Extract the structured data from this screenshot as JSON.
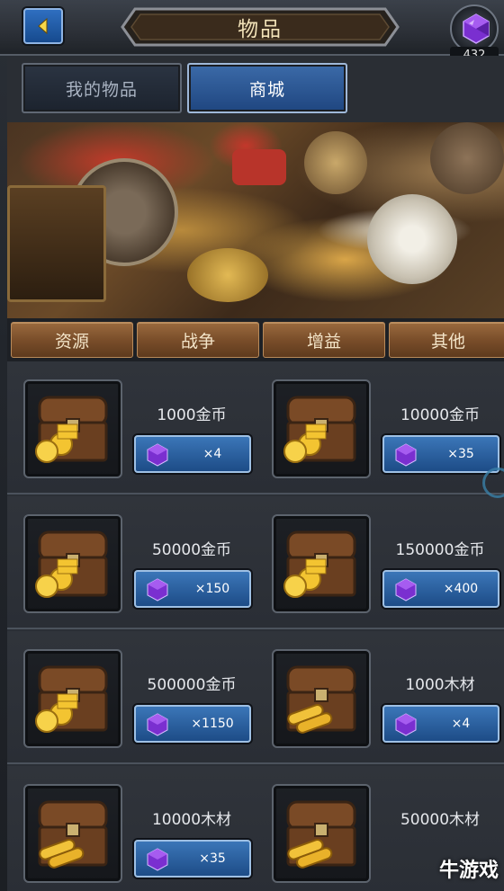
{
  "header": {
    "title": "物品",
    "gem_count": "432",
    "icons": {
      "back": "back-arrow-icon",
      "currency": "purple-gem-icon"
    }
  },
  "tabs": [
    {
      "label": "我的物品",
      "active": false
    },
    {
      "label": "商城",
      "active": true
    }
  ],
  "categories": [
    {
      "label": "资源"
    },
    {
      "label": "战争"
    },
    {
      "label": "增益"
    },
    {
      "label": "其他"
    }
  ],
  "items": [
    {
      "name": "1000金币",
      "price": "×4",
      "icon": "gold-chest-icon"
    },
    {
      "name": "10000金币",
      "price": "×35",
      "icon": "gold-chest-icon"
    },
    {
      "name": "50000金币",
      "price": "×150",
      "icon": "gold-chest-icon"
    },
    {
      "name": "150000金币",
      "price": "×400",
      "icon": "gold-chest-icon"
    },
    {
      "name": "500000金币",
      "price": "×1150",
      "icon": "gold-chest-icon"
    },
    {
      "name": "1000木材",
      "price": "×4",
      "icon": "wood-chest-icon"
    },
    {
      "name": "10000木材",
      "price": "×35",
      "icon": "wood-chest-icon"
    },
    {
      "name": "50000木材",
      "price": "",
      "icon": "wood-chest-icon"
    }
  ],
  "watermark": "牛游戏",
  "colors": {
    "accent_blue": "#2f6fc0",
    "category_brown": "#7a4e2a",
    "gem_purple": "#8a3fd9",
    "title_text": "#f2e2b8"
  }
}
